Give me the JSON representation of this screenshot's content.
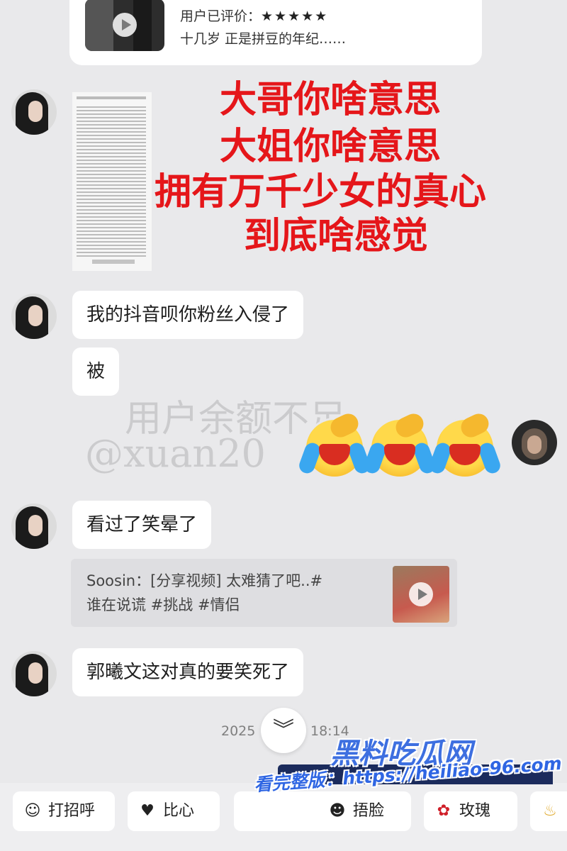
{
  "product_card": {
    "rating_label": "用户已评价：",
    "stars": "★★★★★",
    "description": "十几岁 正是拼豆的年纪……"
  },
  "overlay_caption": {
    "line1": "大哥你啥意思",
    "line2": "大姐你啥意思",
    "line3": "拥有万千少女的真心",
    "line4": "到底啥感觉"
  },
  "messages": {
    "m1": "我的抖音呗你粉丝入侵了",
    "m2": "被",
    "m3": "看过了笑晕了",
    "m4": "郭曦文这对真的要笑死了"
  },
  "watermark": {
    "line1": "用户余额不足",
    "line2": "@xuan20"
  },
  "shared_video": {
    "line1": "Soosin：[分享视频] 太难猜了吧..#",
    "line2": "谁在说谎 #挑战 #情侣"
  },
  "timestamp": {
    "date_part": "2025",
    "time_part": "18:14"
  },
  "quick_replies": [
    {
      "label": "打招呼",
      "icon": "wave-emoji-icon"
    },
    {
      "label": "比心",
      "icon": "heart-hands-icon"
    },
    {
      "label": "捂脸",
      "icon": "facepalm-icon"
    },
    {
      "label": "玫瑰",
      "icon": "rose-icon"
    }
  ],
  "site_watermark": {
    "brand": "黑料吃瓜网",
    "promo": "看完整版：https://heiliao-96.com"
  },
  "colors": {
    "caption_red": "#e5161a",
    "background": "#e9e9eb",
    "brand_blue": "#3d6fe0"
  }
}
